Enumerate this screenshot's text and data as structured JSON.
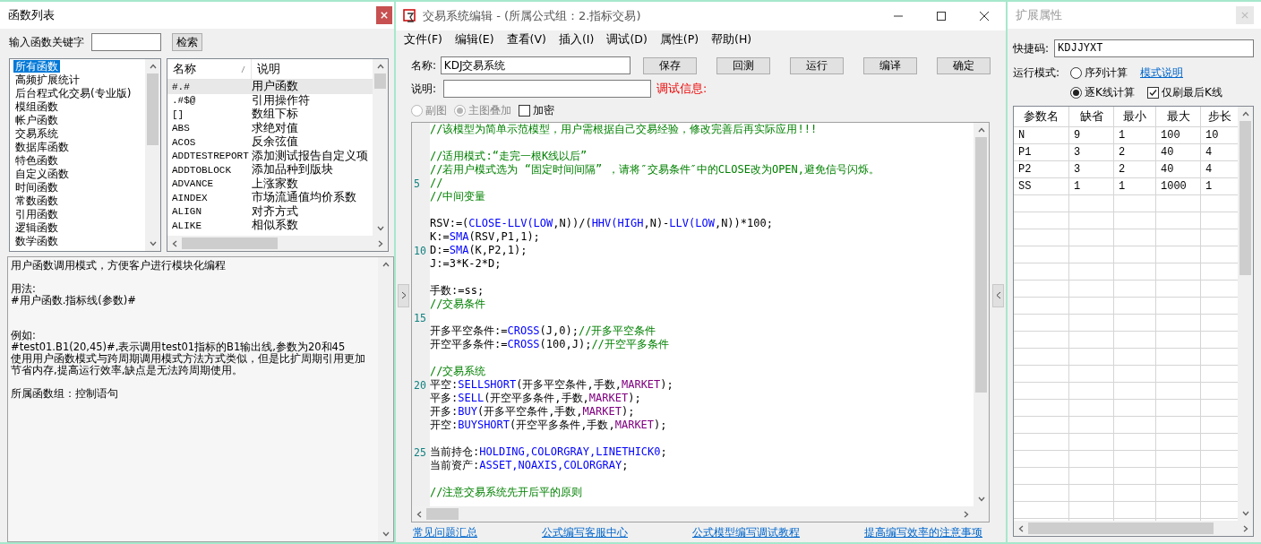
{
  "functions_window": {
    "title": "函数列表",
    "keyword_label": "输入函数关键字",
    "search_button": "检索",
    "categories": [
      {
        "label": "所有函数",
        "selected": true
      },
      {
        "label": "高频扩展统计",
        "selected": false
      },
      {
        "label": "后台程式化交易(专业版)",
        "selected": false
      },
      {
        "label": "模组函数",
        "selected": false
      },
      {
        "label": "帐户函数",
        "selected": false
      },
      {
        "label": "交易系统",
        "selected": false
      },
      {
        "label": "数据库函数",
        "selected": false
      },
      {
        "label": "特色函数",
        "selected": false
      },
      {
        "label": "自定义函数",
        "selected": false
      },
      {
        "label": "时间函数",
        "selected": false
      },
      {
        "label": "常数函数",
        "selected": false
      },
      {
        "label": "引用函数",
        "selected": false
      },
      {
        "label": "逻辑函数",
        "selected": false
      },
      {
        "label": "数学函数",
        "selected": false
      }
    ],
    "table": {
      "columns": [
        "名称",
        "说明"
      ],
      "rows": [
        {
          "name": "#.#",
          "description": "用户函数",
          "selected": true
        },
        {
          "name": ".#$@",
          "description": "引用操作符",
          "selected": false
        },
        {
          "name": "[]",
          "description": "数组下标",
          "selected": false
        },
        {
          "name": "ABS",
          "description": "求绝对值",
          "selected": false
        },
        {
          "name": "ACOS",
          "description": "反余弦值",
          "selected": false
        },
        {
          "name": "ADDTESTREPORT",
          "description": "添加测试报告自定义项",
          "selected": false
        },
        {
          "name": "ADDTOBLOCK",
          "description": "添加品种到版块",
          "selected": false
        },
        {
          "name": "ADVANCE",
          "description": "上涨家数",
          "selected": false
        },
        {
          "name": "AINDEX",
          "description": "市场流通值均价系数",
          "selected": false
        },
        {
          "name": "ALIGN",
          "description": "对齐方式",
          "selected": false
        },
        {
          "name": "ALIKE",
          "description": "相似系数",
          "selected": false
        }
      ]
    },
    "help": [
      {
        "kind": "text",
        "text": "用户函数调用模式，方便客户进行模块化编程"
      },
      {
        "kind": "gap"
      },
      {
        "kind": "text",
        "text": "用法:"
      },
      {
        "kind": "text",
        "text": "#用户函数.指标线(参数)#"
      },
      {
        "kind": "gap"
      },
      {
        "kind": "gap"
      },
      {
        "kind": "text",
        "text": "例如:"
      },
      {
        "kind": "text",
        "text": "#test01.B1(20,45)#,表示调用test01指标的B1输出线,参数为20和45"
      },
      {
        "kind": "text",
        "text": "使用用户函数模式与跨周期调用模式方法方式类似，但是比扩周期引用更加节省内存,提高运行效率,缺点是无法跨周期使用。"
      },
      {
        "kind": "gap"
      },
      {
        "kind": "text",
        "text": "所属函数组：控制语句"
      }
    ]
  },
  "editor_window": {
    "title": "交易系统编辑 - (所属公式组：2.指标交易)",
    "menu": [
      "文件(F)",
      "编辑(E)",
      "查看(V)",
      "插入(I)",
      "调试(D)",
      "属性(P)",
      "帮助(H)"
    ],
    "name_label": "名称:",
    "name_value": "KDJ交易系统",
    "buttons": [
      "保存",
      "回测",
      "运行",
      "编译",
      "确定"
    ],
    "desc_label": "说明:",
    "debug_label": "调试信息:",
    "chart_modes": [
      {
        "label": "副图",
        "selected": false,
        "disabled": true
      },
      {
        "label": "主图叠加",
        "selected": true,
        "disabled": true
      }
    ],
    "encrypt": {
      "label": "加密",
      "checked": false
    },
    "lines": [
      {
        "kind": "code",
        "tokens": [
          {
            "kind": "comment",
            "text": "//该模型为简单示范模型，用户需根据自己交易经验，修改完善后再实际应用!!!"
          }
        ]
      },
      {
        "kind": "blank"
      },
      {
        "kind": "code",
        "tokens": [
          {
            "kind": "comment",
            "text": "//适用模式:“走完一根K线以后”"
          }
        ]
      },
      {
        "kind": "code",
        "tokens": [
          {
            "kind": "comment",
            "text": "//若用户模式选为 “固定时间间隔” ，请将″交易条件″中的CLOSE改为OPEN,避免信号闪烁。"
          }
        ]
      },
      {
        "kind": "code",
        "number": "5",
        "tokens": [
          {
            "kind": "comment",
            "text": "//"
          }
        ]
      },
      {
        "kind": "code",
        "tokens": [
          {
            "kind": "comment",
            "text": "//中间变量"
          }
        ]
      },
      {
        "kind": "blank"
      },
      {
        "kind": "code",
        "tokens": [
          {
            "kind": "plain",
            "text": "RSV:=("
          },
          {
            "kind": "function",
            "text": "CLOSE-LLV(LOW"
          },
          {
            "kind": "plain",
            "text": ",N))/("
          },
          {
            "kind": "function",
            "text": "HHV(HIGH"
          },
          {
            "kind": "plain",
            "text": ",N)-"
          },
          {
            "kind": "function",
            "text": "LLV(LOW"
          },
          {
            "kind": "plain",
            "text": ",N))*100;"
          }
        ]
      },
      {
        "kind": "code",
        "tokens": [
          {
            "kind": "plain",
            "text": "K:="
          },
          {
            "kind": "function",
            "text": "SMA"
          },
          {
            "kind": "plain",
            "text": "(RSV,P1,1);"
          }
        ]
      },
      {
        "kind": "code",
        "number": "10",
        "tokens": [
          {
            "kind": "plain",
            "text": "D:="
          },
          {
            "kind": "function",
            "text": "SMA"
          },
          {
            "kind": "plain",
            "text": "(K,P2,1);"
          }
        ]
      },
      {
        "kind": "code",
        "tokens": [
          {
            "kind": "plain",
            "text": "J:=3*K-2*D;"
          }
        ]
      },
      {
        "kind": "blank"
      },
      {
        "kind": "code",
        "tokens": [
          {
            "kind": "plain",
            "text": "手数:=ss;"
          }
        ]
      },
      {
        "kind": "code",
        "tokens": [
          {
            "kind": "comment",
            "text": "//交易条件"
          }
        ]
      },
      {
        "kind": "blank",
        "number": "15"
      },
      {
        "kind": "code",
        "tokens": [
          {
            "kind": "plain",
            "text": "开多平空条件:="
          },
          {
            "kind": "function",
            "text": "CROSS"
          },
          {
            "kind": "plain",
            "text": "(J,0);"
          },
          {
            "kind": "comment",
            "text": "//开多平空条件"
          }
        ]
      },
      {
        "kind": "code",
        "tokens": [
          {
            "kind": "plain",
            "text": "开空平多条件:="
          },
          {
            "kind": "function",
            "text": "CROSS"
          },
          {
            "kind": "plain",
            "text": "(100,J);"
          },
          {
            "kind": "comment",
            "text": "//开空平多条件"
          }
        ]
      },
      {
        "kind": "blank"
      },
      {
        "kind": "code",
        "tokens": [
          {
            "kind": "comment",
            "text": "//交易系统"
          }
        ]
      },
      {
        "kind": "code",
        "number": "20",
        "tokens": [
          {
            "kind": "plain",
            "text": "平空:"
          },
          {
            "kind": "function",
            "text": "SELLSHORT"
          },
          {
            "kind": "plain",
            "text": "(开多平空条件,手数,"
          },
          {
            "kind": "constant",
            "text": "MARKET"
          },
          {
            "kind": "plain",
            "text": ");"
          }
        ]
      },
      {
        "kind": "code",
        "tokens": [
          {
            "kind": "plain",
            "text": "平多:"
          },
          {
            "kind": "function",
            "text": "SELL"
          },
          {
            "kind": "plain",
            "text": "(开空平多条件,手数,"
          },
          {
            "kind": "constant",
            "text": "MARKET"
          },
          {
            "kind": "plain",
            "text": ");"
          }
        ]
      },
      {
        "kind": "code",
        "tokens": [
          {
            "kind": "plain",
            "text": "开多:"
          },
          {
            "kind": "function",
            "text": "BUY"
          },
          {
            "kind": "plain",
            "text": "(开多平空条件,手数,"
          },
          {
            "kind": "constant",
            "text": "MARKET"
          },
          {
            "kind": "plain",
            "text": ");"
          }
        ]
      },
      {
        "kind": "code",
        "tokens": [
          {
            "kind": "plain",
            "text": "开空:"
          },
          {
            "kind": "function",
            "text": "BUYSHORT"
          },
          {
            "kind": "plain",
            "text": "(开空平多条件,手数,"
          },
          {
            "kind": "constant",
            "text": "MARKET"
          },
          {
            "kind": "plain",
            "text": ");"
          }
        ]
      },
      {
        "kind": "blank"
      },
      {
        "kind": "code",
        "number": "25",
        "tokens": [
          {
            "kind": "plain",
            "text": "当前持仓:"
          },
          {
            "kind": "function",
            "text": "HOLDING,COLORGRAY,LINETHICK0"
          },
          {
            "kind": "plain",
            "text": ";"
          }
        ]
      },
      {
        "kind": "code",
        "tokens": [
          {
            "kind": "plain",
            "text": "当前资产:"
          },
          {
            "kind": "function",
            "text": "ASSET,NOAXIS,COLORGRAY"
          },
          {
            "kind": "plain",
            "text": ";"
          }
        ]
      },
      {
        "kind": "blank"
      },
      {
        "kind": "code",
        "tokens": [
          {
            "kind": "comment",
            "text": "//注意交易系统先开后平的原则"
          }
        ]
      }
    ],
    "links": [
      "常见问题汇总",
      "公式编写客服中心",
      "公式模型编写调试教程",
      "提高编写效率的注意事项"
    ]
  },
  "properties_window": {
    "title": "扩展属性",
    "shortcut_label": "快捷码:",
    "shortcut_value": "KDJJYXT",
    "mode_label": "运行模式:",
    "modes": [
      {
        "label": "序列计算",
        "selected": false
      },
      {
        "label": "逐K线计算",
        "selected": true
      }
    ],
    "mode_help_link": "模式说明",
    "last_bar_only": {
      "label": "仅刷最后K线",
      "checked": true
    },
    "params": {
      "columns": [
        "参数名",
        "缺省",
        "最小",
        "最大",
        "步长"
      ],
      "rows": [
        [
          "N",
          "9",
          "1",
          "100",
          "10"
        ],
        [
          "P1",
          "3",
          "2",
          "40",
          "4"
        ],
        [
          "P2",
          "3",
          "2",
          "40",
          "4"
        ],
        [
          "SS",
          "1",
          "1",
          "1000",
          "1"
        ]
      ]
    }
  }
}
